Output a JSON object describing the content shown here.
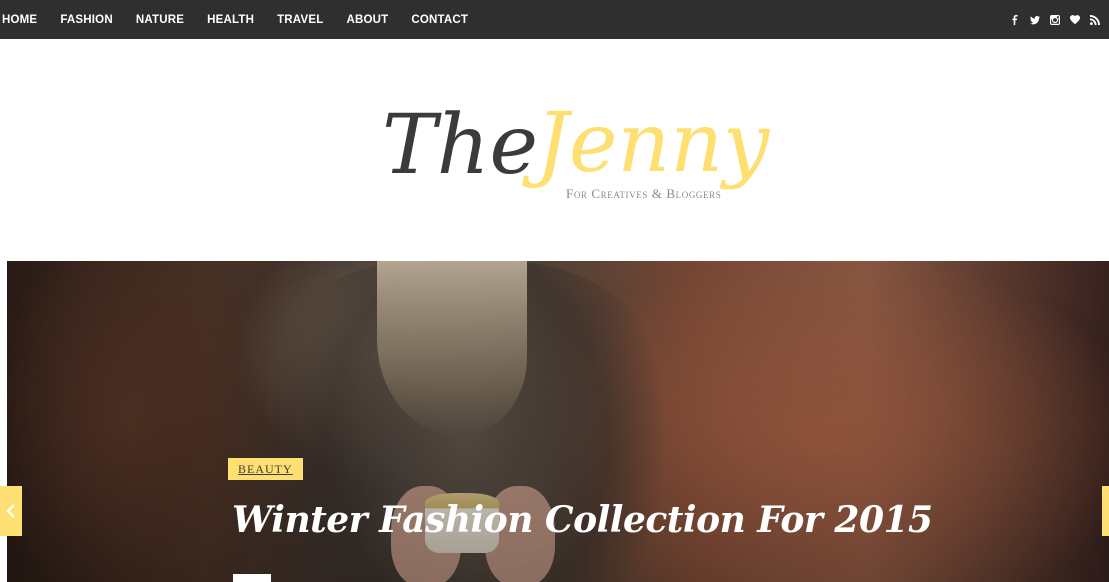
{
  "nav": {
    "items": [
      {
        "label": "HOME"
      },
      {
        "label": "FASHION"
      },
      {
        "label": "NATURE"
      },
      {
        "label": "HEALTH"
      },
      {
        "label": "TRAVEL"
      },
      {
        "label": "ABOUT"
      },
      {
        "label": "CONTACT"
      }
    ],
    "social_icons": [
      "facebook-icon",
      "twitter-icon",
      "instagram-icon",
      "heart-icon",
      "rss-icon"
    ]
  },
  "brand": {
    "logo_word_1": "The",
    "logo_word_2": "Jenny",
    "tagline": "For Creatives & Bloggers"
  },
  "slider": {
    "category": "BEAUTY",
    "title": "Winter Fashion Collection For 2015"
  },
  "colors": {
    "topbar": "#2f2f2f",
    "accent_yellow": "#fde071",
    "logo_dark": "#3b3b3b",
    "tagline_gray": "#8a8a8a"
  }
}
